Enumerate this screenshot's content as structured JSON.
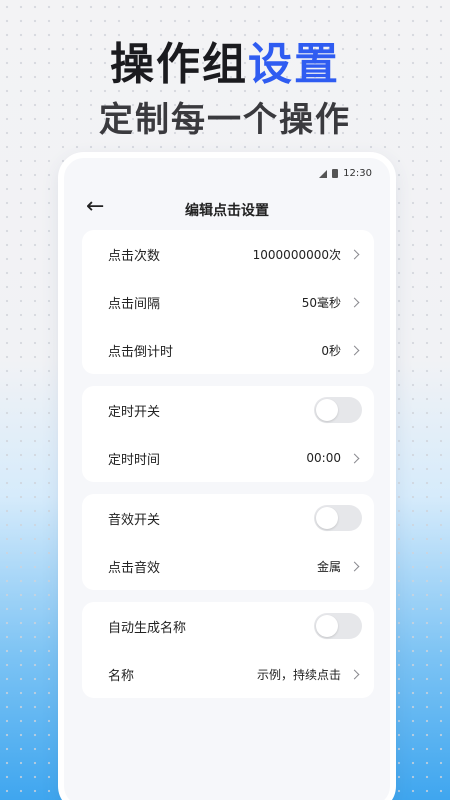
{
  "promo": {
    "headline_part1": "操作组",
    "headline_part2": "设置",
    "subline": "定制每一个操作"
  },
  "status_bar": {
    "time": "12:30"
  },
  "app_bar": {
    "title": "编辑点击设置"
  },
  "sections": {
    "click": {
      "count_label": "点击次数",
      "count_value": "1000000000次",
      "interval_label": "点击间隔",
      "interval_value": "50毫秒",
      "countdown_label": "点击倒计时",
      "countdown_value": "0秒"
    },
    "timer": {
      "switch_label": "定时开关",
      "switch_on": false,
      "time_label": "定时时间",
      "time_value": "00:00"
    },
    "sound": {
      "switch_label": "音效开关",
      "switch_on": false,
      "effect_label": "点击音效",
      "effect_value": "金属"
    },
    "naming": {
      "auto_label": "自动生成名称",
      "auto_on": false,
      "name_label": "名称",
      "name_value": "示例，持续点击"
    }
  },
  "colors": {
    "accent": "#2f5cf1",
    "headline": "#1b1b1f",
    "card": "#ffffff",
    "toggle_off": "#e6e7ea"
  }
}
